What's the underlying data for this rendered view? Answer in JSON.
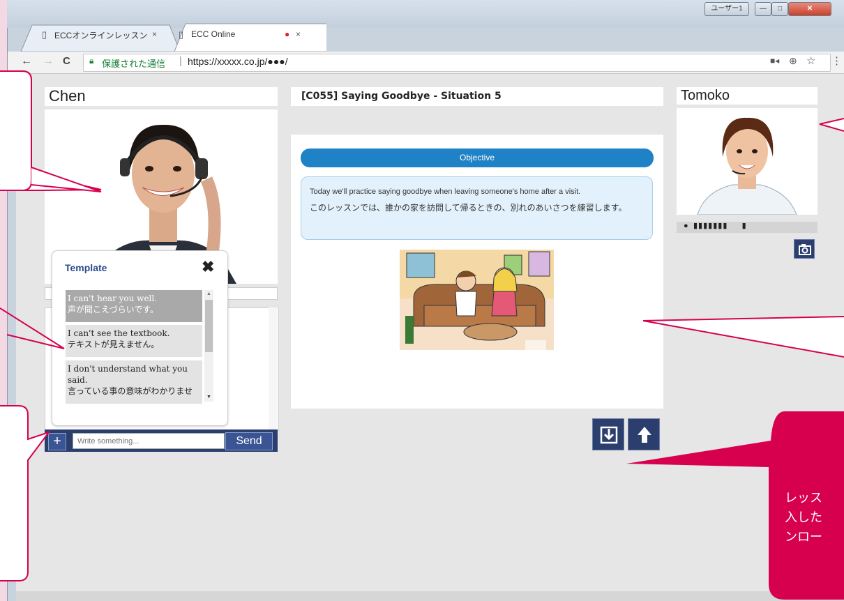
{
  "browser": {
    "tabs": [
      {
        "label": "ECCオンラインレッスン",
        "close": "×"
      },
      {
        "label": "ECC Online",
        "close": "×"
      }
    ],
    "window_controls": {
      "user": "ユーザー1",
      "minimize": "—",
      "maximize": "□",
      "close": "✕"
    },
    "nav": {
      "back": "←",
      "forward": "→",
      "reload": "C"
    },
    "secure_label": "保護された通信",
    "url": "https://xxxxx.co.jp/●●●/",
    "icons": [
      "camera-icon",
      "zoom-icon",
      "star-icon",
      "menu-icon"
    ]
  },
  "teacher": {
    "name": "Chen"
  },
  "student": {
    "name": "Tomoko"
  },
  "chat": {
    "placeholder": "Write something...",
    "send_label": "Send",
    "plus_label": "+"
  },
  "template": {
    "title": "Template",
    "close": "✖",
    "items": [
      {
        "en": "I can't hear you well.",
        "ja": "声が聞こえづらいです。"
      },
      {
        "en": "I can't see the textbook.",
        "ja": "テキストが見えません。"
      },
      {
        "en": "I don't understand what you said.",
        "ja": "言っている事の意味がわかりませ"
      }
    ]
  },
  "lesson": {
    "title": "[C055] Saying Goodbye - Situation 5",
    "objective_label": "Objective",
    "objective_en": "Today we'll practice saying goodbye when leaving someone's home after a visit.",
    "objective_ja": "このレッスンでは、誰かの家を訪問して帰るときの、別れのあいさつを練習します。"
  },
  "callout": {
    "text_lines": [
      "レッス",
      "入した",
      "ンロー"
    ]
  },
  "colors": {
    "accent_blue": "#1f82c6",
    "navy": "#2b3e6e",
    "callout_pink": "#d6004f",
    "page_bg": "#e6e6e6"
  }
}
